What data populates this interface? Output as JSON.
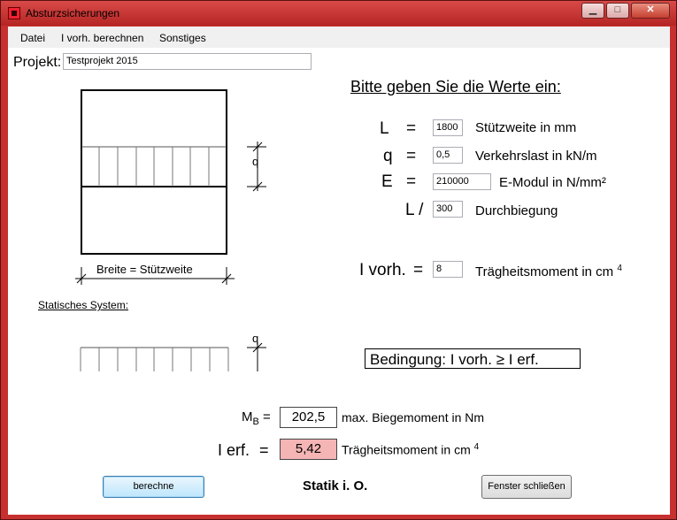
{
  "window": {
    "title": "Absturzsicherungen",
    "controls": {
      "minimize": "▁",
      "maximize": "□",
      "close": "✕"
    }
  },
  "menu": [
    "Datei",
    "I vorh. berechnen",
    "Sonstiges"
  ],
  "project": {
    "label": "Projekt:",
    "value": "Testprojekt 2015"
  },
  "drawing": {
    "q_label": "q",
    "width_label": "Breite = Stützweite",
    "system_label": "Statisches System:",
    "system_q_label": "q"
  },
  "prompt": "Bitte geben Sie die Werte ein:",
  "inputs": [
    {
      "symbol": "L",
      "eq": "=",
      "value": "1800",
      "desc": "Stützweite in mm"
    },
    {
      "symbol": "q",
      "eq": "=",
      "value": "0,5",
      "desc": "Verkehrslast in kN/m"
    },
    {
      "symbol": "E",
      "eq": "=",
      "value": "210000",
      "desc": "E-Modul in N/mm²"
    },
    {
      "symbol": "L /",
      "value": "300",
      "desc": "Durchbiegung"
    }
  ],
  "ivorh": {
    "symbol": "I vorh.",
    "eq": "=",
    "value": "8",
    "desc": "Trägheitsmoment in cm",
    "exp": "4"
  },
  "condition": "Bedingung:   I vorh.  ≥  I erf.",
  "mb": {
    "symbol": "M",
    "sub": "B",
    "eq": "=",
    "value": "202,5",
    "desc": "max. Biegemoment in Nm"
  },
  "ierf": {
    "symbol": "I erf.",
    "eq": "=",
    "value": "5,42",
    "desc": "Trägheitsmoment in cm",
    "exp": "4"
  },
  "buttons": {
    "compute": "berechne",
    "close": "Fenster schließen"
  },
  "status": "Statik i. O.",
  "colors": {
    "frame": "#c6302e",
    "ierf_bg": "#f5b5b5",
    "default_button": "#bee6fd"
  }
}
